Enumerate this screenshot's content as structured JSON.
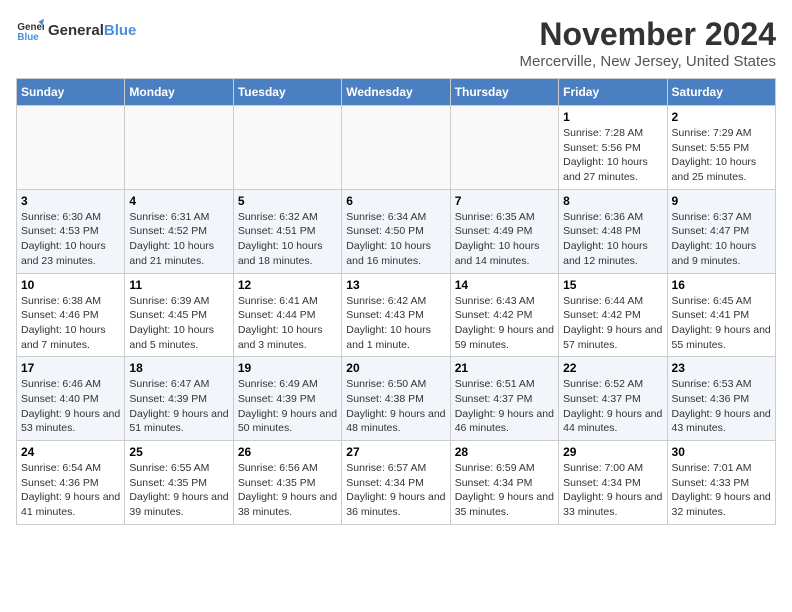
{
  "header": {
    "logo_general": "General",
    "logo_blue": "Blue",
    "month_title": "November 2024",
    "location": "Mercerville, New Jersey, United States"
  },
  "days_of_week": [
    "Sunday",
    "Monday",
    "Tuesday",
    "Wednesday",
    "Thursday",
    "Friday",
    "Saturday"
  ],
  "weeks": [
    [
      {
        "day": "",
        "info": ""
      },
      {
        "day": "",
        "info": ""
      },
      {
        "day": "",
        "info": ""
      },
      {
        "day": "",
        "info": ""
      },
      {
        "day": "",
        "info": ""
      },
      {
        "day": "1",
        "info": "Sunrise: 7:28 AM\nSunset: 5:56 PM\nDaylight: 10 hours and 27 minutes."
      },
      {
        "day": "2",
        "info": "Sunrise: 7:29 AM\nSunset: 5:55 PM\nDaylight: 10 hours and 25 minutes."
      }
    ],
    [
      {
        "day": "3",
        "info": "Sunrise: 6:30 AM\nSunset: 4:53 PM\nDaylight: 10 hours and 23 minutes."
      },
      {
        "day": "4",
        "info": "Sunrise: 6:31 AM\nSunset: 4:52 PM\nDaylight: 10 hours and 21 minutes."
      },
      {
        "day": "5",
        "info": "Sunrise: 6:32 AM\nSunset: 4:51 PM\nDaylight: 10 hours and 18 minutes."
      },
      {
        "day": "6",
        "info": "Sunrise: 6:34 AM\nSunset: 4:50 PM\nDaylight: 10 hours and 16 minutes."
      },
      {
        "day": "7",
        "info": "Sunrise: 6:35 AM\nSunset: 4:49 PM\nDaylight: 10 hours and 14 minutes."
      },
      {
        "day": "8",
        "info": "Sunrise: 6:36 AM\nSunset: 4:48 PM\nDaylight: 10 hours and 12 minutes."
      },
      {
        "day": "9",
        "info": "Sunrise: 6:37 AM\nSunset: 4:47 PM\nDaylight: 10 hours and 9 minutes."
      }
    ],
    [
      {
        "day": "10",
        "info": "Sunrise: 6:38 AM\nSunset: 4:46 PM\nDaylight: 10 hours and 7 minutes."
      },
      {
        "day": "11",
        "info": "Sunrise: 6:39 AM\nSunset: 4:45 PM\nDaylight: 10 hours and 5 minutes."
      },
      {
        "day": "12",
        "info": "Sunrise: 6:41 AM\nSunset: 4:44 PM\nDaylight: 10 hours and 3 minutes."
      },
      {
        "day": "13",
        "info": "Sunrise: 6:42 AM\nSunset: 4:43 PM\nDaylight: 10 hours and 1 minute."
      },
      {
        "day": "14",
        "info": "Sunrise: 6:43 AM\nSunset: 4:42 PM\nDaylight: 9 hours and 59 minutes."
      },
      {
        "day": "15",
        "info": "Sunrise: 6:44 AM\nSunset: 4:42 PM\nDaylight: 9 hours and 57 minutes."
      },
      {
        "day": "16",
        "info": "Sunrise: 6:45 AM\nSunset: 4:41 PM\nDaylight: 9 hours and 55 minutes."
      }
    ],
    [
      {
        "day": "17",
        "info": "Sunrise: 6:46 AM\nSunset: 4:40 PM\nDaylight: 9 hours and 53 minutes."
      },
      {
        "day": "18",
        "info": "Sunrise: 6:47 AM\nSunset: 4:39 PM\nDaylight: 9 hours and 51 minutes."
      },
      {
        "day": "19",
        "info": "Sunrise: 6:49 AM\nSunset: 4:39 PM\nDaylight: 9 hours and 50 minutes."
      },
      {
        "day": "20",
        "info": "Sunrise: 6:50 AM\nSunset: 4:38 PM\nDaylight: 9 hours and 48 minutes."
      },
      {
        "day": "21",
        "info": "Sunrise: 6:51 AM\nSunset: 4:37 PM\nDaylight: 9 hours and 46 minutes."
      },
      {
        "day": "22",
        "info": "Sunrise: 6:52 AM\nSunset: 4:37 PM\nDaylight: 9 hours and 44 minutes."
      },
      {
        "day": "23",
        "info": "Sunrise: 6:53 AM\nSunset: 4:36 PM\nDaylight: 9 hours and 43 minutes."
      }
    ],
    [
      {
        "day": "24",
        "info": "Sunrise: 6:54 AM\nSunset: 4:36 PM\nDaylight: 9 hours and 41 minutes."
      },
      {
        "day": "25",
        "info": "Sunrise: 6:55 AM\nSunset: 4:35 PM\nDaylight: 9 hours and 39 minutes."
      },
      {
        "day": "26",
        "info": "Sunrise: 6:56 AM\nSunset: 4:35 PM\nDaylight: 9 hours and 38 minutes."
      },
      {
        "day": "27",
        "info": "Sunrise: 6:57 AM\nSunset: 4:34 PM\nDaylight: 9 hours and 36 minutes."
      },
      {
        "day": "28",
        "info": "Sunrise: 6:59 AM\nSunset: 4:34 PM\nDaylight: 9 hours and 35 minutes."
      },
      {
        "day": "29",
        "info": "Sunrise: 7:00 AM\nSunset: 4:34 PM\nDaylight: 9 hours and 33 minutes."
      },
      {
        "day": "30",
        "info": "Sunrise: 7:01 AM\nSunset: 4:33 PM\nDaylight: 9 hours and 32 minutes."
      }
    ]
  ]
}
